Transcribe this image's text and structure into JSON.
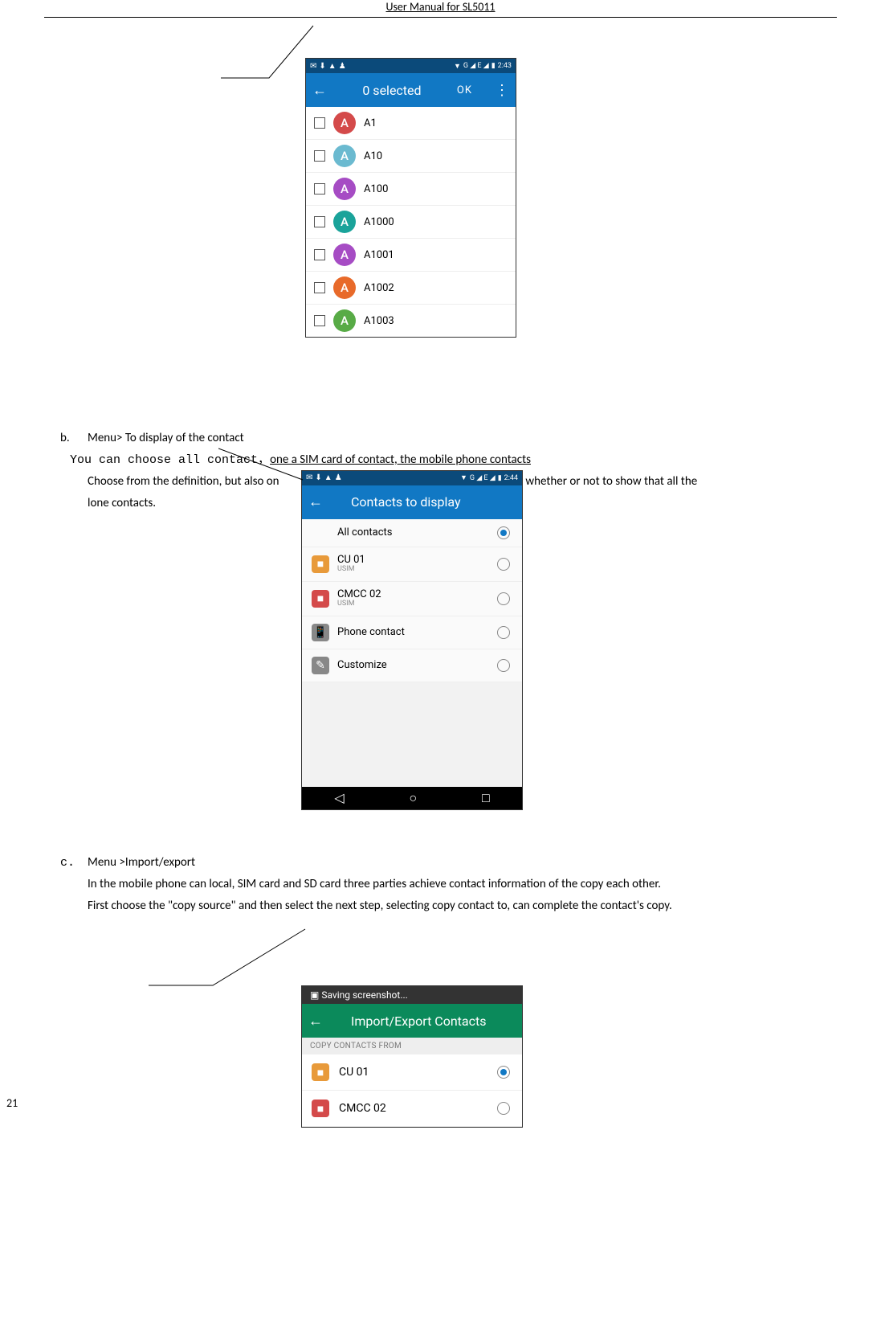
{
  "header": {
    "title": "User Manual for SL5011"
  },
  "page_number": "21",
  "shot1": {
    "status_time": "2:43",
    "status_net": "G ◢ E ◢",
    "topbar_title": "0 selected",
    "topbar_ok": "OK",
    "contacts": [
      {
        "letter": "A",
        "name": "A1",
        "color": "#d44a4a"
      },
      {
        "letter": "A",
        "name": "A10",
        "color": "#6bbad0"
      },
      {
        "letter": "A",
        "name": "A100",
        "color": "#a64cc4"
      },
      {
        "letter": "A",
        "name": "A1000",
        "color": "#1aa39a"
      },
      {
        "letter": "A",
        "name": "A1001",
        "color": "#a64cc4"
      },
      {
        "letter": "A",
        "name": "A1002",
        "color": "#e86a2a"
      },
      {
        "letter": "A",
        "name": "A1003",
        "color": "#58ab46"
      }
    ]
  },
  "section_b": {
    "bullet": "b.",
    "heading": "Menu> To display of the contact",
    "line1_pre": "You can choose all contact",
    "line1_comma": "，",
    "line1_rest": "one a SIM card of contact, the mobile phone contacts",
    "line2_left": "Choose from the definition, but also on",
    "line2_right": "whether or not to show that all the",
    "line3": "lone contacts."
  },
  "shot2": {
    "status_time": "2:44",
    "status_net": "G ◢ E ◢",
    "topbar_title": "Contacts to display",
    "rows": [
      {
        "label": "All contacts",
        "sub": "",
        "icon": "",
        "color": "",
        "selected": true
      },
      {
        "label": "CU 01",
        "sub": "USIM",
        "icon": "■",
        "color": "#e89a3a",
        "selected": false
      },
      {
        "label": "CMCC 02",
        "sub": "USIM",
        "icon": "■",
        "color": "#d44a4a",
        "selected": false
      },
      {
        "label": "Phone contact",
        "sub": "",
        "icon": "📱",
        "color": "#888",
        "selected": false
      },
      {
        "label": "Customize",
        "sub": "",
        "icon": "✎",
        "color": "#888",
        "selected": false
      }
    ]
  },
  "section_c": {
    "bullet": "c.",
    "heading": "Menu >Import/export",
    "line1": "In the mobile phone can local, SIM card and SD card three parties achieve contact information of the copy each other.",
    "line2": "First choose the \"copy source\" and then select the next step, selecting copy contact to, can complete the contact's copy."
  },
  "shot3": {
    "saving": "Saving screenshot...",
    "topbar_title": "Import/Export Contacts",
    "group": "COPY CONTACTS FROM",
    "rows": [
      {
        "label": "CU 01",
        "icon": "■",
        "color": "#e89a3a",
        "selected": true
      },
      {
        "label": "CMCC 02",
        "icon": "■",
        "color": "#d44a4a",
        "selected": false
      }
    ]
  }
}
